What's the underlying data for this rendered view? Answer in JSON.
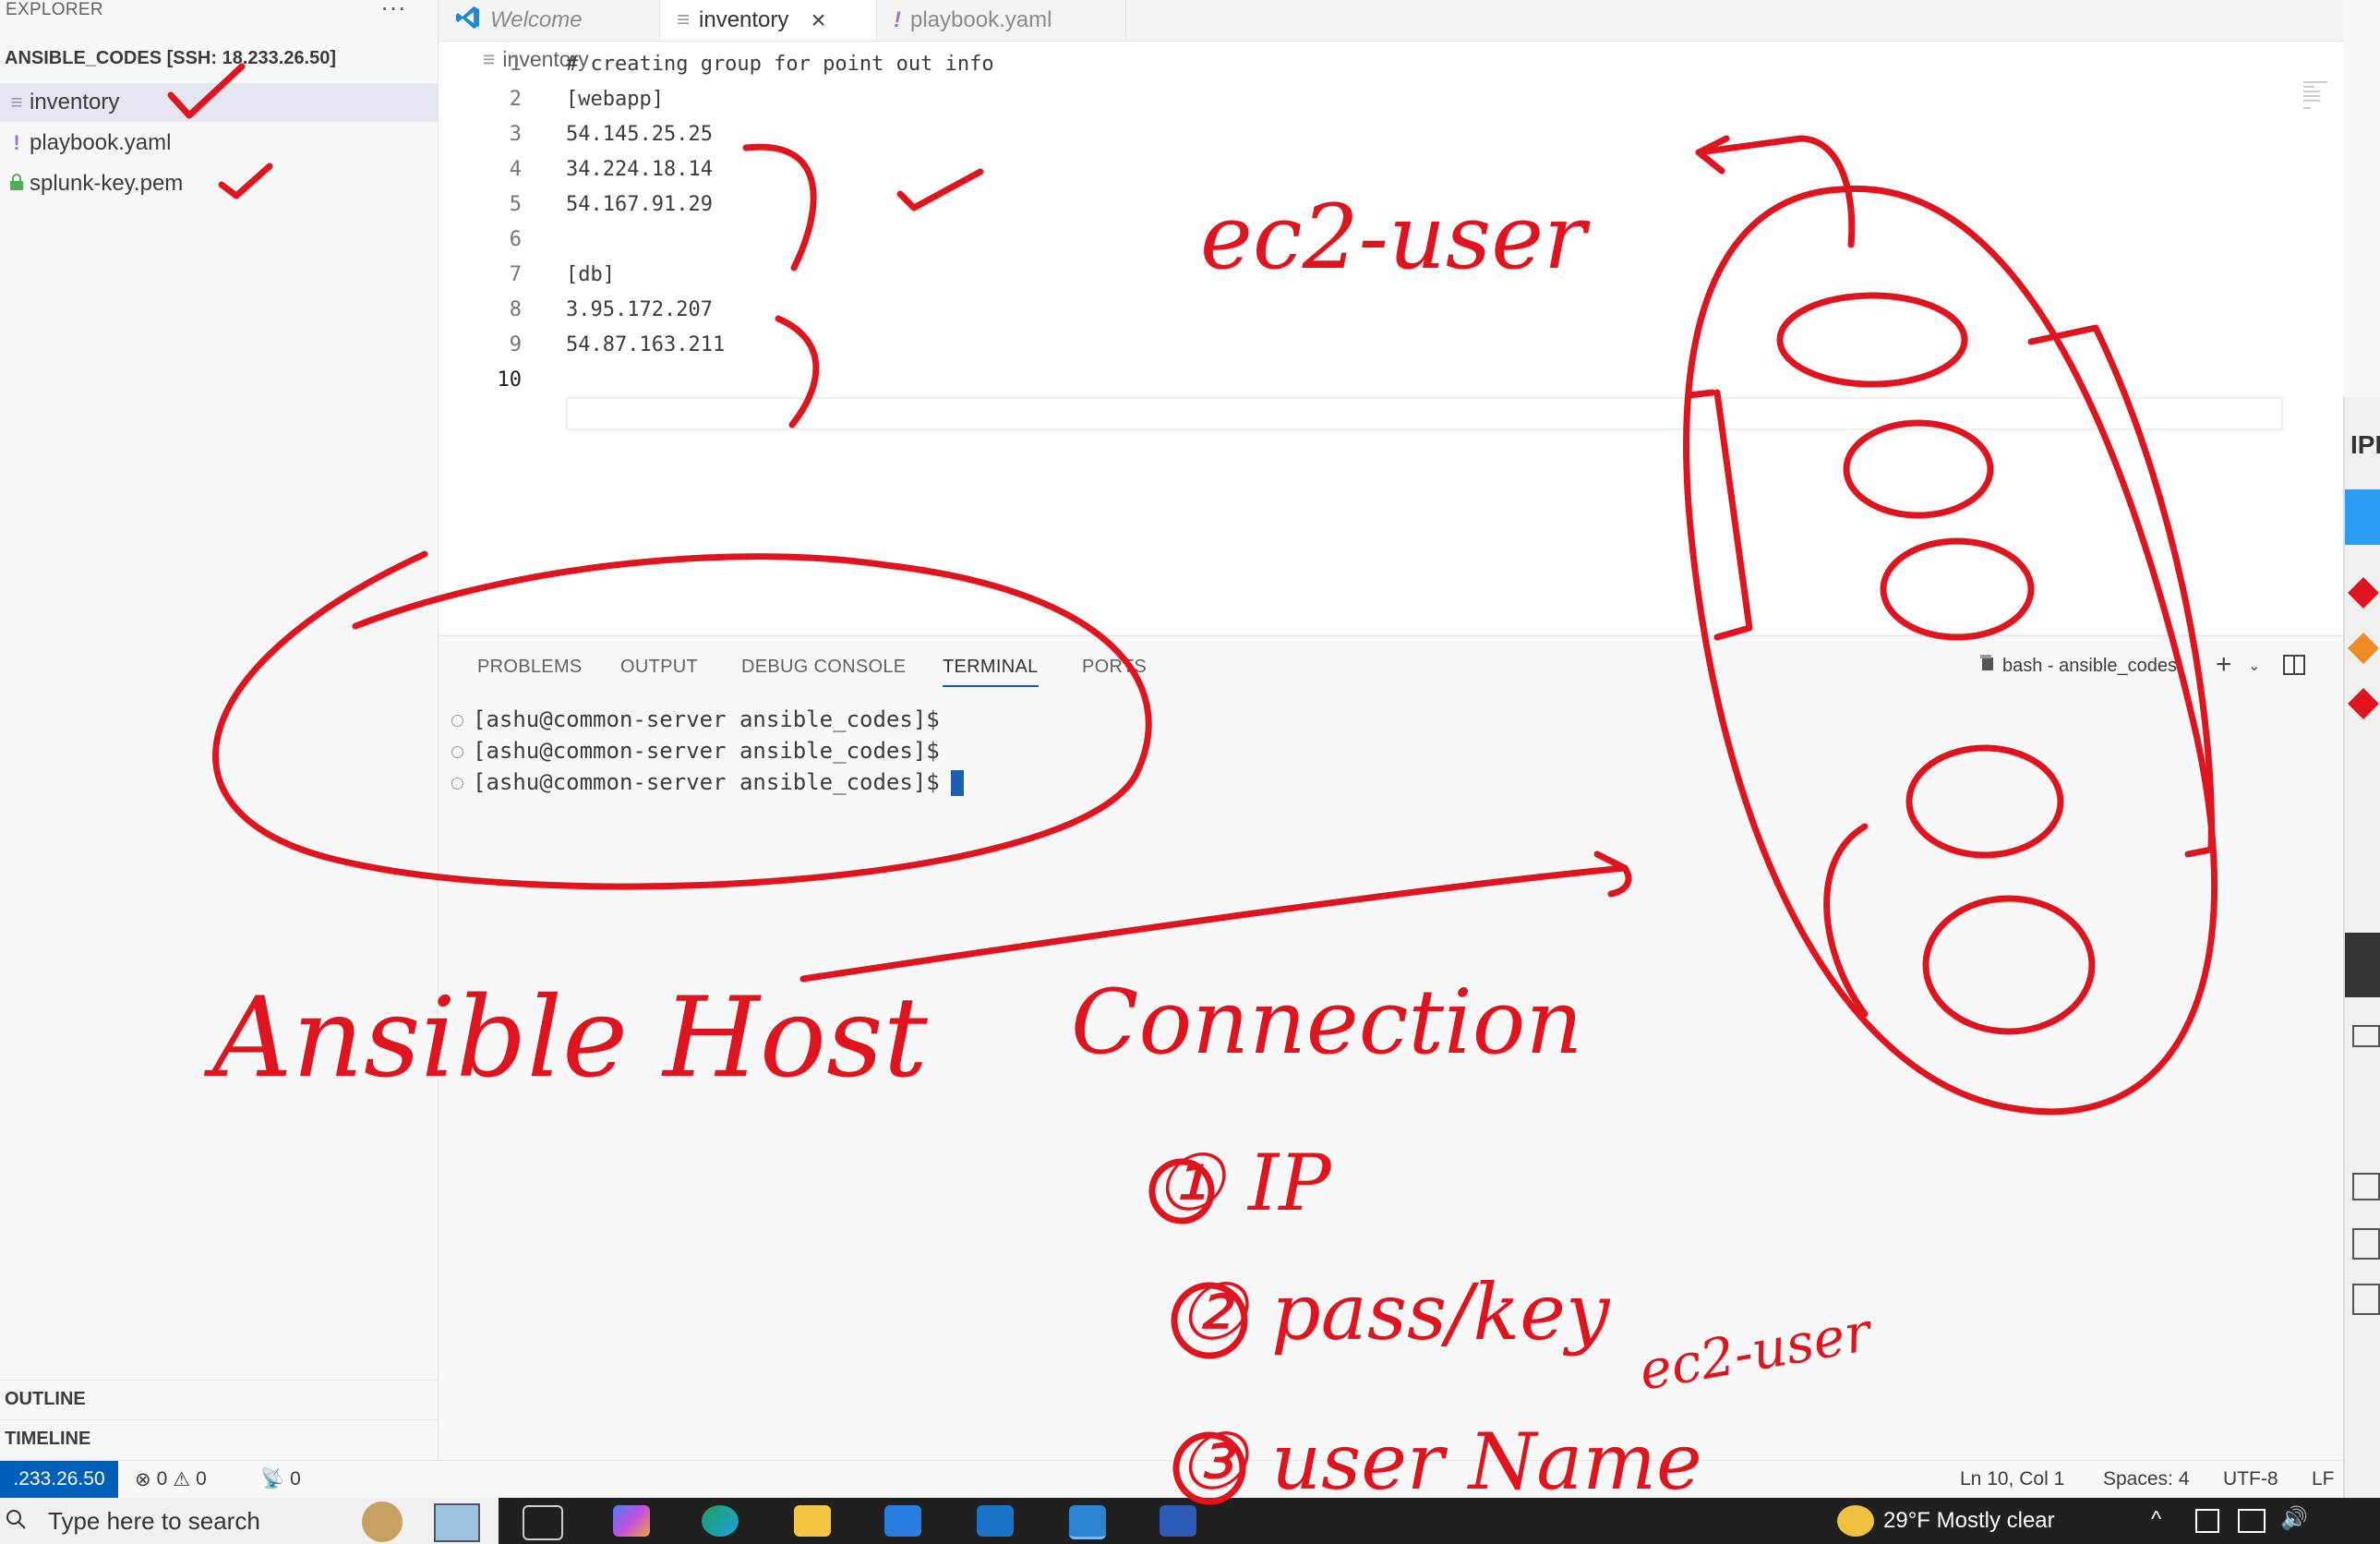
{
  "sidebar": {
    "header": "EXPLORER",
    "more": "···",
    "folder": "ANSIBLE_CODES [SSH: 18.233.26.50]",
    "files": [
      {
        "name": "inventory",
        "icon": "≡"
      },
      {
        "name": "playbook.yaml",
        "icon": "!"
      },
      {
        "name": "splunk-key.pem",
        "icon": "🔒"
      }
    ],
    "outline": "OUTLINE",
    "timeline": "TIMELINE"
  },
  "tabs": [
    {
      "label": "Welcome",
      "icon": "vscode-logo-icon"
    },
    {
      "label": "inventory",
      "close": "×"
    },
    {
      "label": "playbook.yaml"
    }
  ],
  "editor": {
    "breadcrumb": "inventory",
    "lines": [
      {
        "n": "1",
        "text": "# creating group for point out info"
      },
      {
        "n": "2",
        "text": "[webapp]"
      },
      {
        "n": "3",
        "text": "54.145.25.25"
      },
      {
        "n": "4",
        "text": "34.224.18.14"
      },
      {
        "n": "5",
        "text": "54.167.91.29"
      },
      {
        "n": "6",
        "text": ""
      },
      {
        "n": "7",
        "text": "[db]"
      },
      {
        "n": "8",
        "text": "3.95.172.207"
      },
      {
        "n": "9",
        "text": "54.87.163.211"
      },
      {
        "n": "10",
        "text": ""
      }
    ]
  },
  "panel": {
    "tabs": [
      "PROBLEMS",
      "OUTPUT",
      "DEBUG CONSOLE",
      "TERMINAL",
      "PORTS"
    ],
    "terminal_name": "bash - ansible_codes",
    "lines": [
      "[ashu@common-server ansible_codes]$",
      "[ashu@common-server ansible_codes]$",
      "[ashu@common-server ansible_codes]$"
    ]
  },
  "status": {
    "remote": ".233.26.50",
    "errors": "0",
    "warnings": "0",
    "ports": "0",
    "position": "Ln 10, Col 1",
    "spaces": "Spaces: 4",
    "encoding": "UTF-8",
    "eol": "LF"
  },
  "taskbar": {
    "search_placeholder": "Type here to search",
    "weather": "29°F  Mostly clear"
  },
  "ipe": {
    "label": "IPE"
  },
  "annotations": {
    "ec2_user": "ec2-user",
    "ansible_host": "Ansible Host",
    "connection": "Connection",
    "item1": "① IP",
    "item2": "② pass/key",
    "item3": "③ user Name",
    "ec2_user_small": "ec2-user",
    "ink_color": "#e0141e"
  },
  "colors": {
    "accent": "#005fb8",
    "ink": "#e0141e"
  }
}
